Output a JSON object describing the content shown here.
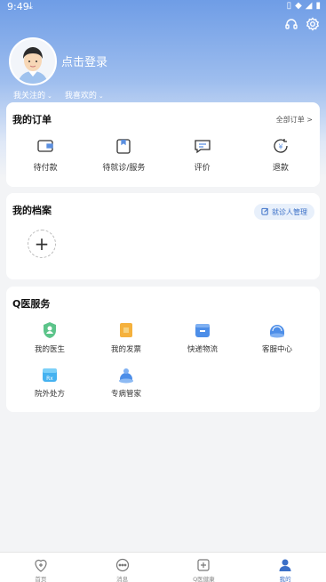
{
  "status_bar": {
    "time": "9:49"
  },
  "profile": {
    "login_label": "点击登录",
    "follow_label": "我关注的",
    "like_label": "我喜欢的"
  },
  "orders": {
    "title": "我的订单",
    "all_label": "全部订单 >",
    "items": [
      {
        "label": "待付款",
        "icon": "wallet-icon"
      },
      {
        "label": "待就诊/服务",
        "icon": "clipboard-icon"
      },
      {
        "label": "评价",
        "icon": "comment-icon"
      },
      {
        "label": "退款",
        "icon": "refund-icon"
      }
    ]
  },
  "records": {
    "title": "我的档案",
    "manage_label": "就诊人管理"
  },
  "services": {
    "title": "Q医服务",
    "items": [
      {
        "label": "我的医生",
        "icon": "doctor-icon"
      },
      {
        "label": "我的发票",
        "icon": "invoice-icon"
      },
      {
        "label": "快递物流",
        "icon": "express-icon"
      },
      {
        "label": "客服中心",
        "icon": "support-icon"
      },
      {
        "label": "院外处方",
        "icon": "prescription-icon"
      },
      {
        "label": "专病管家",
        "icon": "manager-icon"
      }
    ]
  },
  "bottom_nav": [
    {
      "label": "首页",
      "icon": "home-icon",
      "active": false
    },
    {
      "label": "消息",
      "icon": "message-icon",
      "active": false
    },
    {
      "label": "Q医健康",
      "icon": "health-icon",
      "active": false
    },
    {
      "label": "我的",
      "icon": "profile-icon",
      "active": true
    }
  ],
  "colors": {
    "accent": "#3a6fc7",
    "hero_top": "#6f9de6"
  }
}
